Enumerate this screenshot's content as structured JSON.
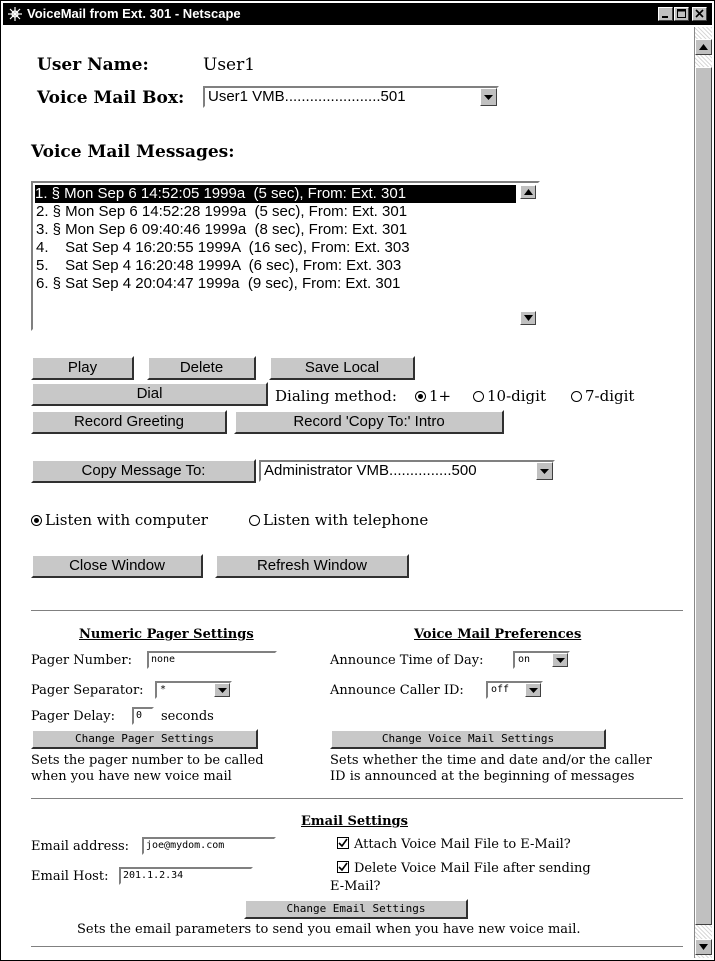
{
  "window": {
    "title": "VoiceMail from Ext. 301 - Netscape",
    "logo_icon": "netscape-logo-icon",
    "controls": [
      "minimize",
      "maximize",
      "close"
    ]
  },
  "user": {
    "name_label": "User Name:",
    "name_value": "User1",
    "mailbox_label": "Voice Mail Box:",
    "mailbox_value": "User1 VMB.......................501"
  },
  "messages": {
    "heading": "Voice Mail Messages:",
    "items": [
      "1. § Mon Sep 6 14:52:05 1999a  (5 sec), From: Ext. 301",
      "2. § Mon Sep 6 14:52:28 1999a  (5 sec), From: Ext. 301",
      "3. § Mon Sep 6 09:40:46 1999a  (8 sec), From: Ext. 301",
      "4.    Sat Sep 4 16:20:55 1999A  (16 sec), From: Ext. 303",
      "5.    Sat Sep 4 16:20:48 1999A  (6 sec), From: Ext. 303",
      "6. § Sat Sep 4 20:04:47 1999a  (9 sec), From: Ext. 301"
    ],
    "selected_index": 0
  },
  "actions": {
    "play": "Play",
    "delete": "Delete",
    "save_local": "Save Local",
    "dial": "Dial",
    "dialing_method_label": "Dialing method:",
    "dial_options": [
      "1+",
      "10-digit",
      "7-digit"
    ],
    "dial_selected": "1+",
    "record_greeting": "Record Greeting",
    "record_copy_intro": "Record 'Copy To:' Intro",
    "copy_message_to": "Copy Message To:",
    "copy_target": "Administrator VMB...............500",
    "listen_computer": "Listen with computer",
    "listen_telephone": "Listen with telephone",
    "listen_selected": "computer",
    "close_window": "Close Window",
    "refresh_window": "Refresh Window"
  },
  "pager": {
    "heading": "Numeric Pager Settings",
    "number_label": "Pager Number:",
    "number_value": "none",
    "separator_label": "Pager Separator:",
    "separator_value": "*",
    "delay_label": "Pager Delay:",
    "delay_value": "0",
    "delay_unit": "seconds",
    "button": "Change Pager Settings",
    "desc_line1": "Sets the pager number to be called",
    "desc_line2": "when you have new voice mail"
  },
  "prefs": {
    "heading": "Voice Mail Preferences",
    "time_label": "Announce Time of Day:",
    "time_value": "on",
    "caller_label": "Announce Caller ID:",
    "caller_value": "off",
    "button": "Change Voice Mail Settings",
    "desc_line1": "Sets whether the time and date and/or the caller",
    "desc_line2": "ID is announced at the beginning of messages"
  },
  "email": {
    "heading": "Email Settings",
    "address_label": "Email address:",
    "address_value": "joe@mydom.com",
    "host_label": "Email Host:",
    "host_value": "201.1.2.34",
    "attach_label": "Attach Voice Mail File to E-Mail?",
    "attach_checked": true,
    "delete_label_line1": "Delete Voice Mail File after sending",
    "delete_label_line2": "E-Mail?",
    "delete_checked": true,
    "button": "Change Email Settings",
    "desc": "Sets the email parameters to send you email when you have new voice mail."
  }
}
